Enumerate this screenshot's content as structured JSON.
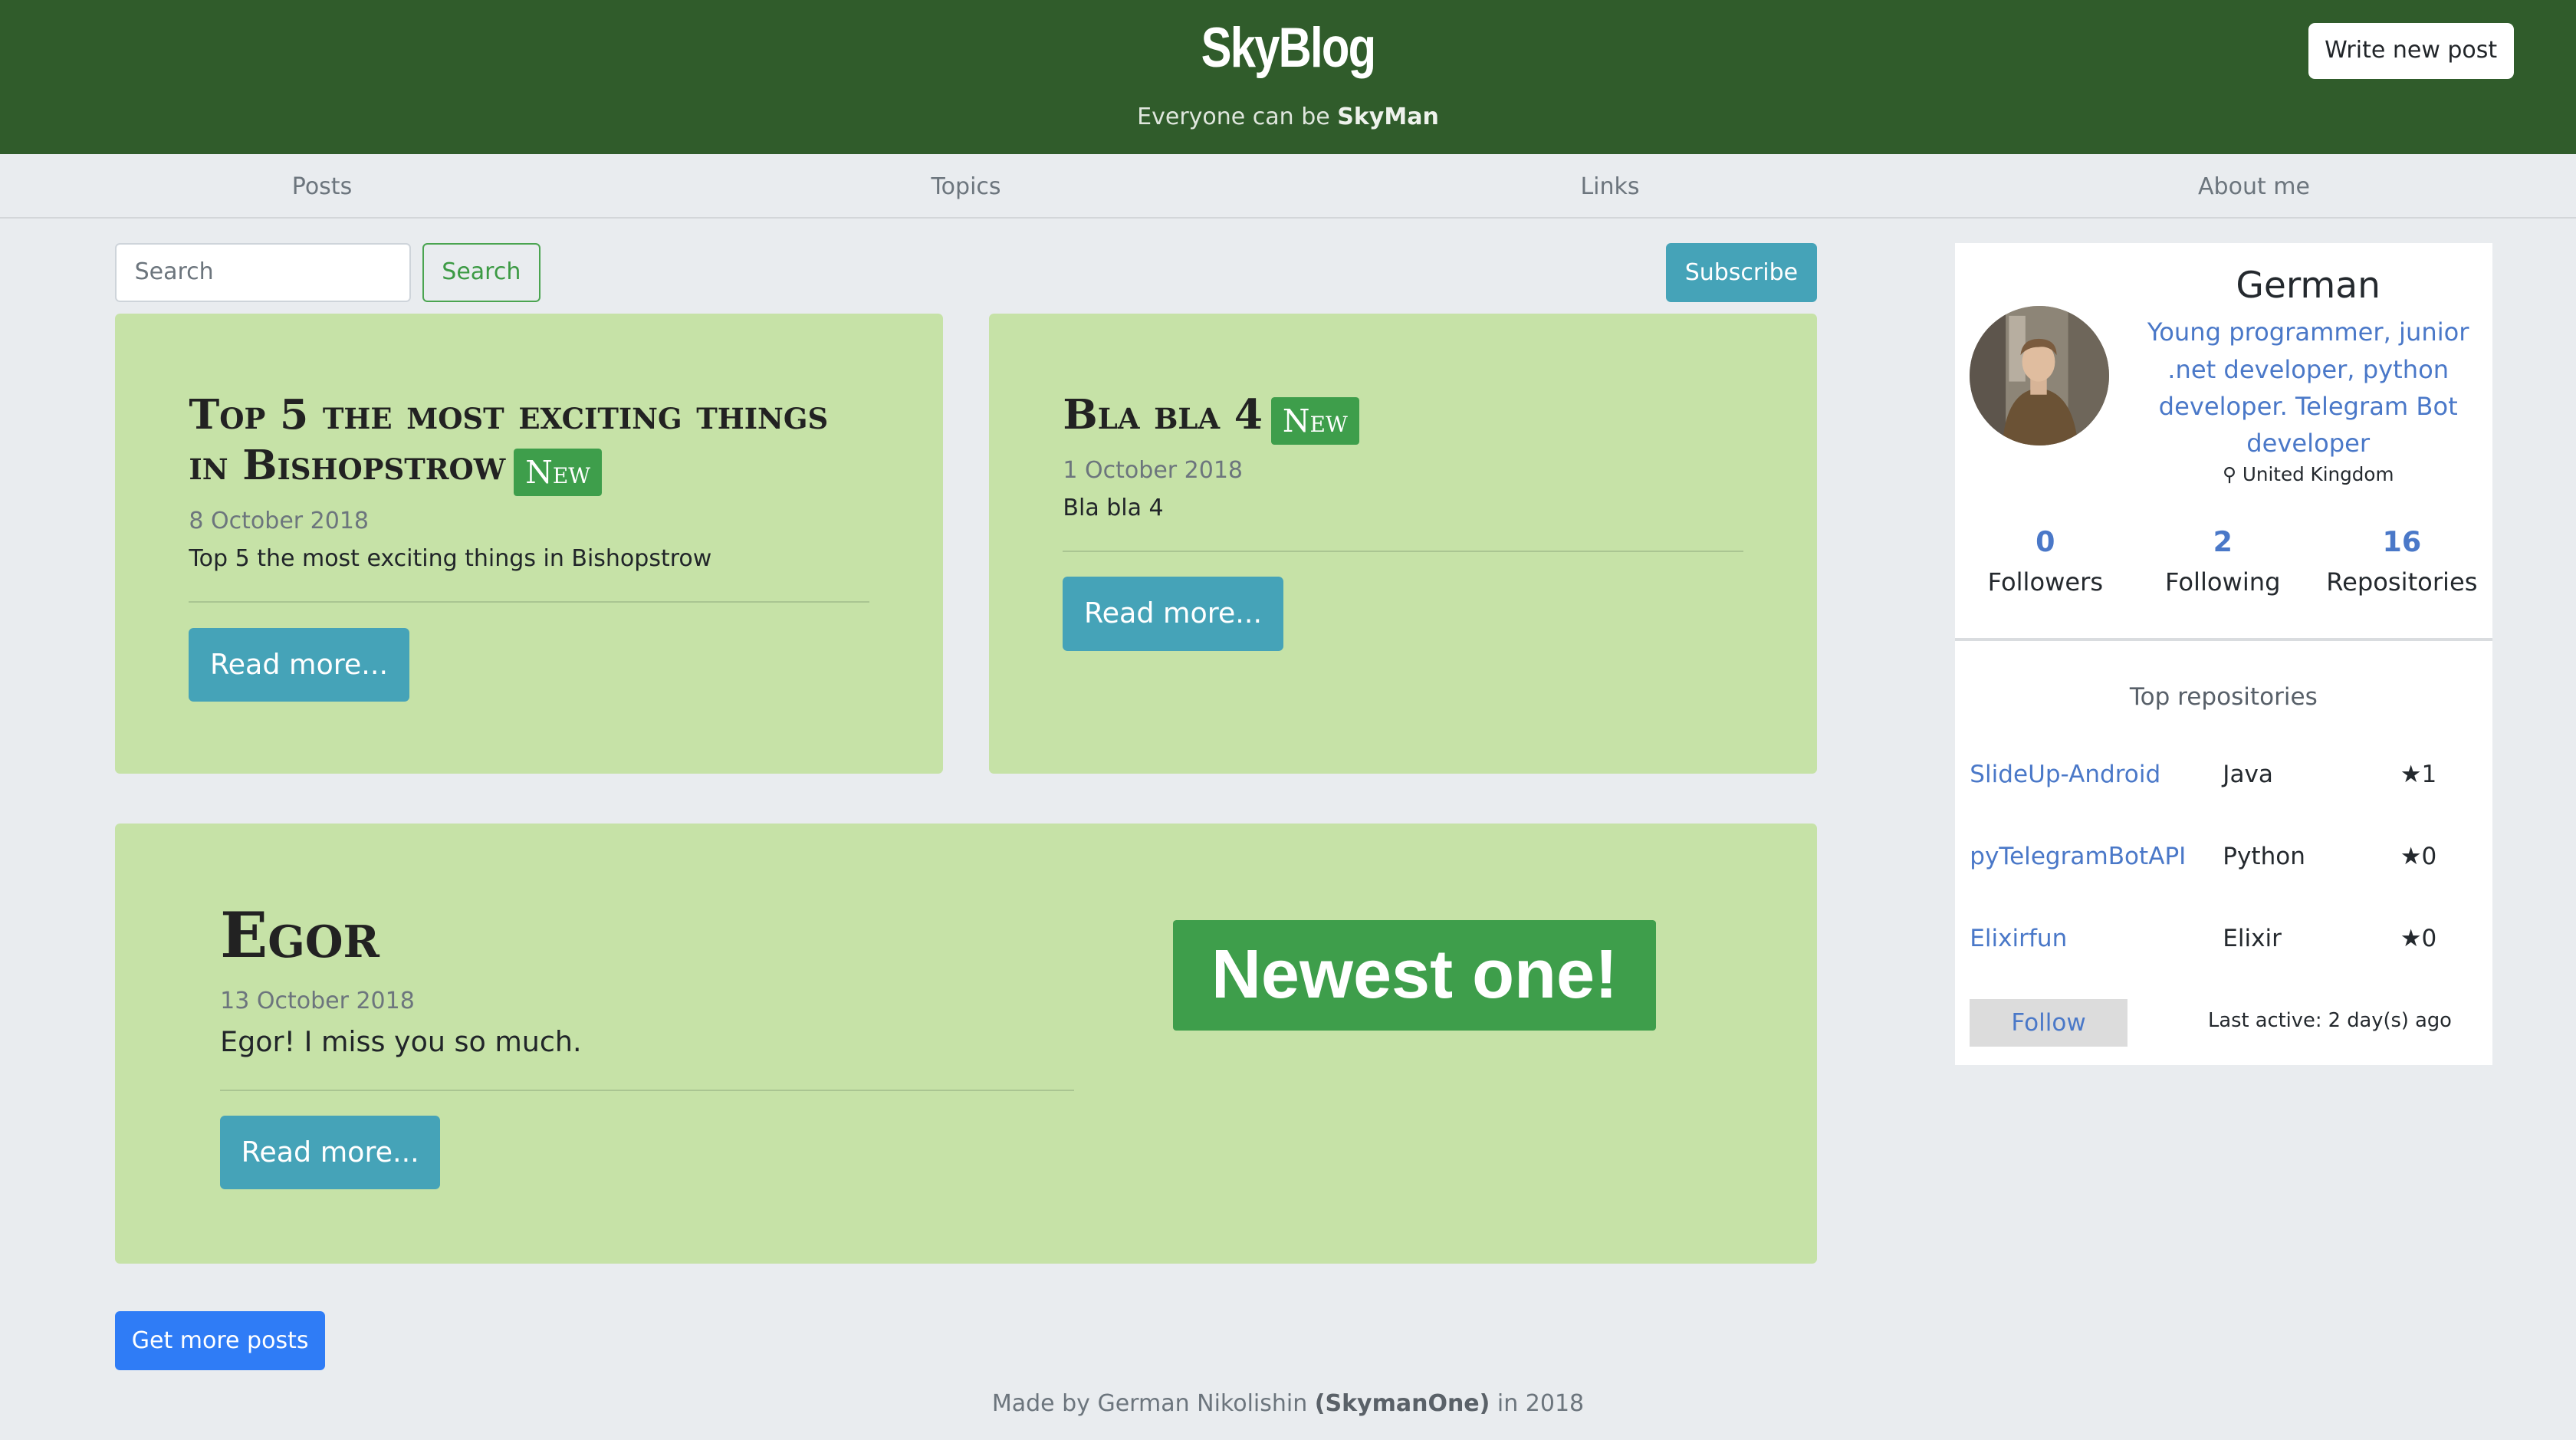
{
  "header": {
    "brand": "SkyBlog",
    "tagline_prefix": "Everyone can be ",
    "tagline_name": "SkyMan",
    "write_button": "Write new post"
  },
  "nav": {
    "items": [
      {
        "label": "Posts"
      },
      {
        "label": "Topics"
      },
      {
        "label": "Links"
      },
      {
        "label": "About me"
      }
    ]
  },
  "toolbar": {
    "search_placeholder": "Search",
    "search_button": "Search",
    "subscribe_button": "Subscribe"
  },
  "posts": [
    {
      "title": "Top 5 the most exciting things in Bishopstrow",
      "badge": "New",
      "date": "8 October 2018",
      "excerpt": "Top 5 the most exciting things in Bishopstrow",
      "read_more": "Read more..."
    },
    {
      "title": "Bla bla 4",
      "badge": "New",
      "date": "1 October 2018",
      "excerpt": "Bla bla 4",
      "read_more": "Read more..."
    }
  ],
  "featured": {
    "title": "Egor",
    "date": "13 October 2018",
    "excerpt": "Egor! I miss you so much.",
    "read_more": "Read more...",
    "highlight": "Newest one!"
  },
  "more_button": "Get more posts",
  "footer": {
    "prefix": "Made by German Nikolishin ",
    "handle": "(SkymanOne)",
    "suffix": " in 2018"
  },
  "profile": {
    "name": "German",
    "bio": "Young programmer, junior .net developer, python developer. Telegram Bot developer",
    "location": "United Kingdom",
    "stats": [
      {
        "value": "0",
        "label": "Followers"
      },
      {
        "value": "2",
        "label": "Following"
      },
      {
        "value": "16",
        "label": "Repositories"
      }
    ],
    "repos_title": "Top repositories",
    "repos": [
      {
        "name": "SlideUp-Android",
        "language": "Java",
        "stars": "★1"
      },
      {
        "name": "pyTelegramBotAPI",
        "language": "Python",
        "stars": "★0"
      },
      {
        "name": "Elixirfun",
        "language": "Elixir",
        "stars": "★0"
      }
    ],
    "follow_button": "Follow",
    "last_active": "Last active: 2 day(s) ago"
  },
  "colors": {
    "header_bg": "#305c2b",
    "card_bg": "#c6e2a7",
    "badge_bg": "#3e9e4b",
    "info_button": "#45a3b8",
    "primary_button": "#2f7cf6",
    "link": "#4a78c8"
  }
}
